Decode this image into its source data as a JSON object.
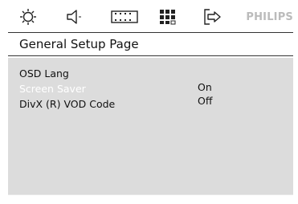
{
  "toolbar": {
    "icons": [
      "general-setup-icon",
      "audio-setup-icon",
      "video-setup-icon",
      "preference-setup-icon",
      "exit-icon"
    ],
    "brand": "PHILIPS"
  },
  "page": {
    "title": "General Setup Page"
  },
  "menu": {
    "items": [
      {
        "label": "OSD Lang",
        "selected": false
      },
      {
        "label": "Screen Saver",
        "selected": true
      },
      {
        "label": "DivX (R) VOD Code",
        "selected": false
      }
    ]
  },
  "options": {
    "items": [
      "On",
      "Off"
    ]
  },
  "colors": {
    "panel_bg": "#dcdcdc",
    "selected_text": "#ffffff",
    "brand": "#bbbbbb"
  }
}
